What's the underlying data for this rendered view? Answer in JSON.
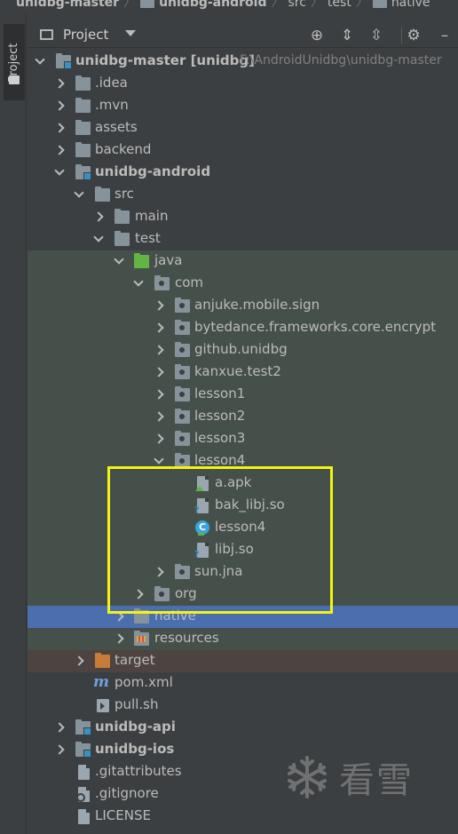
{
  "breadcrumb": [
    {
      "label": "unidbg-master",
      "bold": true,
      "folder": false
    },
    {
      "label": "unidbg-android",
      "bold": true,
      "folder": true
    },
    {
      "label": "src",
      "bold": false,
      "folder": false
    },
    {
      "label": "test",
      "bold": false,
      "folder": false
    },
    {
      "label": "native",
      "bold": false,
      "folder": true
    }
  ],
  "toolstrip": {
    "tab_label": "Project"
  },
  "header": {
    "title": "Project",
    "icons": [
      "locate-icon",
      "expand-all-icon",
      "collapse-all-icon",
      "settings-gear-icon"
    ]
  },
  "tree": {
    "root": {
      "name": "unidbg-master [unidbg]",
      "path": "F:\\AndroidUnidbg\\unidbg-master"
    },
    "rows": [
      {
        "label": ".idea"
      },
      {
        "label": ".mvn"
      },
      {
        "label": "assets"
      },
      {
        "label": "backend"
      },
      {
        "label": "unidbg-android"
      },
      {
        "label": "src"
      },
      {
        "label": "main"
      },
      {
        "label": "test"
      },
      {
        "label": "java"
      },
      {
        "label": "com"
      },
      {
        "label": "anjuke.mobile.sign"
      },
      {
        "label": "bytedance.frameworks.core.encrypt"
      },
      {
        "label": "github.unidbg"
      },
      {
        "label": "kanxue.test2"
      },
      {
        "label": "lesson1"
      },
      {
        "label": "lesson2"
      },
      {
        "label": "lesson3"
      },
      {
        "label": "lesson4"
      },
      {
        "label": "a.apk"
      },
      {
        "label": "bak_libj.so"
      },
      {
        "label": "lesson4"
      },
      {
        "label": "libj.so"
      },
      {
        "label": "sun.jna"
      },
      {
        "label": "org"
      },
      {
        "label": "native"
      },
      {
        "label": "resources"
      },
      {
        "label": "target"
      },
      {
        "label": "pom.xml"
      },
      {
        "label": "pull.sh"
      },
      {
        "label": "unidbg-api"
      },
      {
        "label": "unidbg-ios"
      },
      {
        "label": ".gitattributes"
      },
      {
        "label": ".gitignore"
      },
      {
        "label": "LICENSE"
      }
    ]
  },
  "colors": {
    "background": "#3c3f41",
    "test_band": "#46504a",
    "selection": "#4b6eaf",
    "excluded_band": "#4d4340",
    "highlight_box": "#f4f414"
  },
  "watermark": {
    "text": "看雪"
  }
}
